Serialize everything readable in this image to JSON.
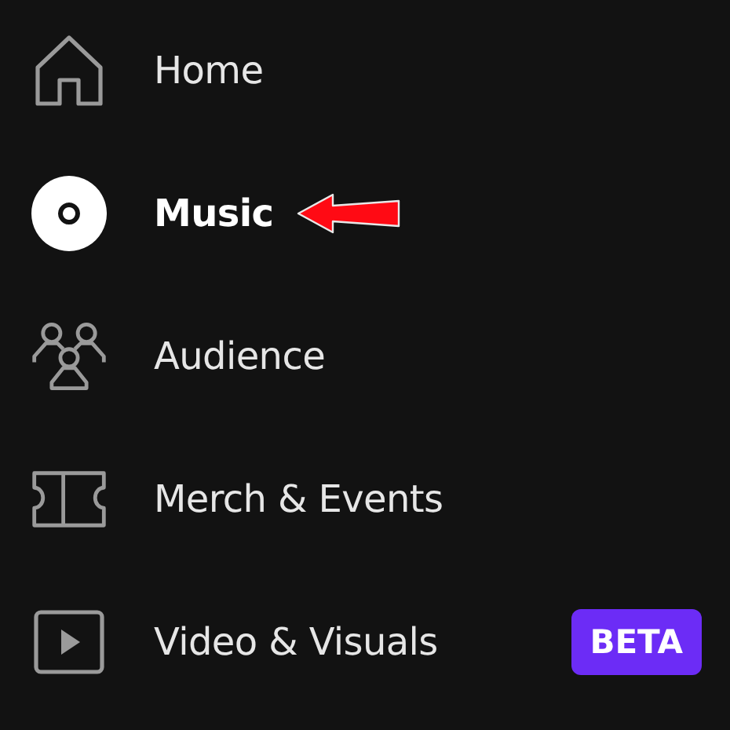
{
  "nav_items": [
    {
      "kind": "home",
      "label": "Home",
      "selected": false
    },
    {
      "kind": "music",
      "label": "Music",
      "selected": true,
      "pointer": true
    },
    {
      "kind": "audience",
      "label": "Audience",
      "selected": false
    },
    {
      "kind": "merch",
      "label": "Merch & Events",
      "selected": false
    },
    {
      "kind": "video",
      "label": "Video & Visuals",
      "selected": false,
      "badge": "BETA"
    }
  ]
}
